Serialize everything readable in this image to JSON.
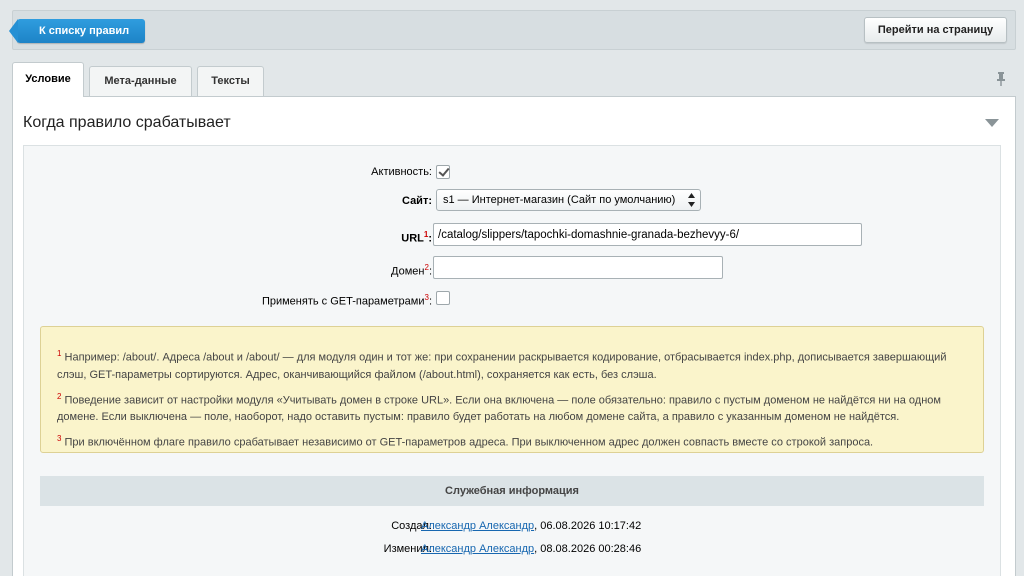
{
  "toolbar": {
    "back_label": "К списку правил",
    "goto_label": "Перейти на страницу"
  },
  "tabs": [
    {
      "label": "Условие",
      "active": true
    },
    {
      "label": "Мета-данные",
      "active": false
    },
    {
      "label": "Тексты",
      "active": false
    }
  ],
  "section": {
    "title": "Когда правило срабатывает"
  },
  "form": {
    "active_label": "Активность:",
    "active_checked": true,
    "site_label": "Сайт:",
    "site_value": "s1 — Интернет-магазин (Сайт по умолчанию)",
    "url_label": "URL",
    "url_sup": "1",
    "url_colon": ":",
    "url_value": "/catalog/slippers/tapochki-domashnie-granada-bezhevyy-6/",
    "domain_label": "Домен",
    "domain_sup": "2",
    "domain_colon": ":",
    "domain_value": "",
    "get_label": "Применять с GET-параметрами",
    "get_sup": "3",
    "get_colon": ":",
    "get_checked": false
  },
  "notes": [
    {
      "sup": "1",
      "text": " Например: /about/. Адреса /about и /about/ — для модуля один и тот же: при сохранении раскрывается кодирование, отбрасывается index.php, дописывается завершающий слэш, GET-параметры сортируются. Адрес, оканчивающийся файлом (/about.html), сохраняется как есть, без слэша."
    },
    {
      "sup": "2",
      "text": " Поведение зависит от настройки модуля «Учитывать домен в строке URL». Если она включена — поле обязательно: правило с пустым доменом не найдётся ни на одном домене. Если выключена — поле, наоборот, надо оставить пустым: правило будет работать на любом домене сайта, а правило с указанным доменом не найдётся."
    },
    {
      "sup": "3",
      "text": " При включённом флаге правило срабатывает независимо от GET-параметров адреса. При выключенном адрес должен совпасть вместе со строкой запроса."
    }
  ],
  "service": {
    "title": "Служебная информация",
    "created_label": "Создал:",
    "created_user": "Александр Александр",
    "created_date": ", 06.08.2026 10:17:42",
    "modified_label": "Изменил:",
    "modified_user": "Александр Александр",
    "modified_date": ", 08.08.2026 00:28:46"
  },
  "icons": {
    "pin": "pin-icon",
    "collapse": "chevron-down-icon",
    "select_arrows": "select-arrows-icon"
  }
}
